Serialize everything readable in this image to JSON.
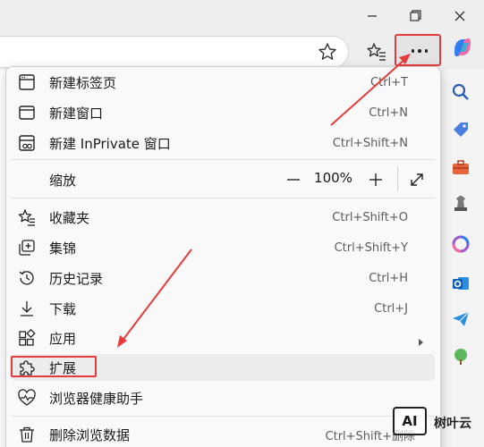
{
  "colors": {
    "highlight": "#e53b3b",
    "menu_bg": "#f9f9f9"
  },
  "menu": {
    "new_tab": {
      "label": "新建标签页",
      "shortcut": "Ctrl+T"
    },
    "new_window": {
      "label": "新建窗口",
      "shortcut": "Ctrl+N"
    },
    "new_inprivate": {
      "label": "新建 InPrivate 窗口",
      "shortcut": "Ctrl+Shift+N"
    },
    "zoom": {
      "label": "缩放",
      "value": "100%",
      "minus": "—",
      "plus": "+"
    },
    "favorites": {
      "label": "收藏夹",
      "shortcut": "Ctrl+Shift+O"
    },
    "collections": {
      "label": "集锦",
      "shortcut": "Ctrl+Shift+Y"
    },
    "history": {
      "label": "历史记录",
      "shortcut": "Ctrl+H"
    },
    "downloads": {
      "label": "下载",
      "shortcut": "Ctrl+J"
    },
    "apps": {
      "label": "应用"
    },
    "extensions": {
      "label": "扩展"
    },
    "browser_essentials": {
      "label": "浏览器健康助手"
    },
    "clear_data": {
      "label": "删除浏览数据",
      "shortcut": "Ctrl+Shift+删除"
    }
  },
  "watermark": {
    "badge": "AI",
    "text": "树叶云"
  }
}
